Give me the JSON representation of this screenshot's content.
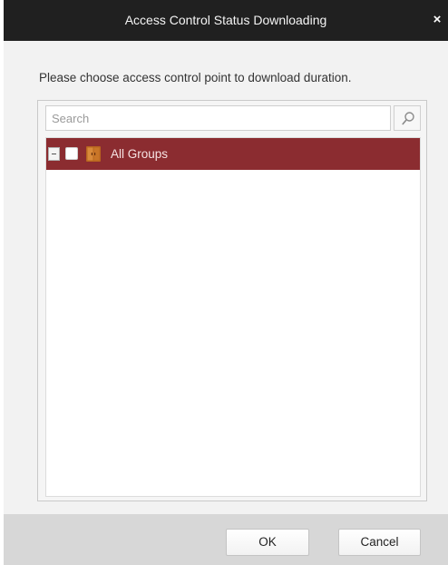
{
  "dialog": {
    "title": "Access Control Status Downloading",
    "close_label": "×",
    "instruction": "Please choose access control point to download duration."
  },
  "search": {
    "placeholder": "Search",
    "value": "",
    "icon": "search-icon"
  },
  "tree": {
    "items": [
      {
        "label": "All Groups",
        "expanded": true,
        "checked": false,
        "selected": true,
        "icon": "group-folder-icon"
      }
    ]
  },
  "buttons": {
    "ok_label": "OK",
    "cancel_label": "Cancel"
  },
  "colors": {
    "title_bar": "#202020",
    "selected_row": "#8b2c30",
    "background": "#f2f2f2",
    "footer": "#d7d7d7"
  }
}
